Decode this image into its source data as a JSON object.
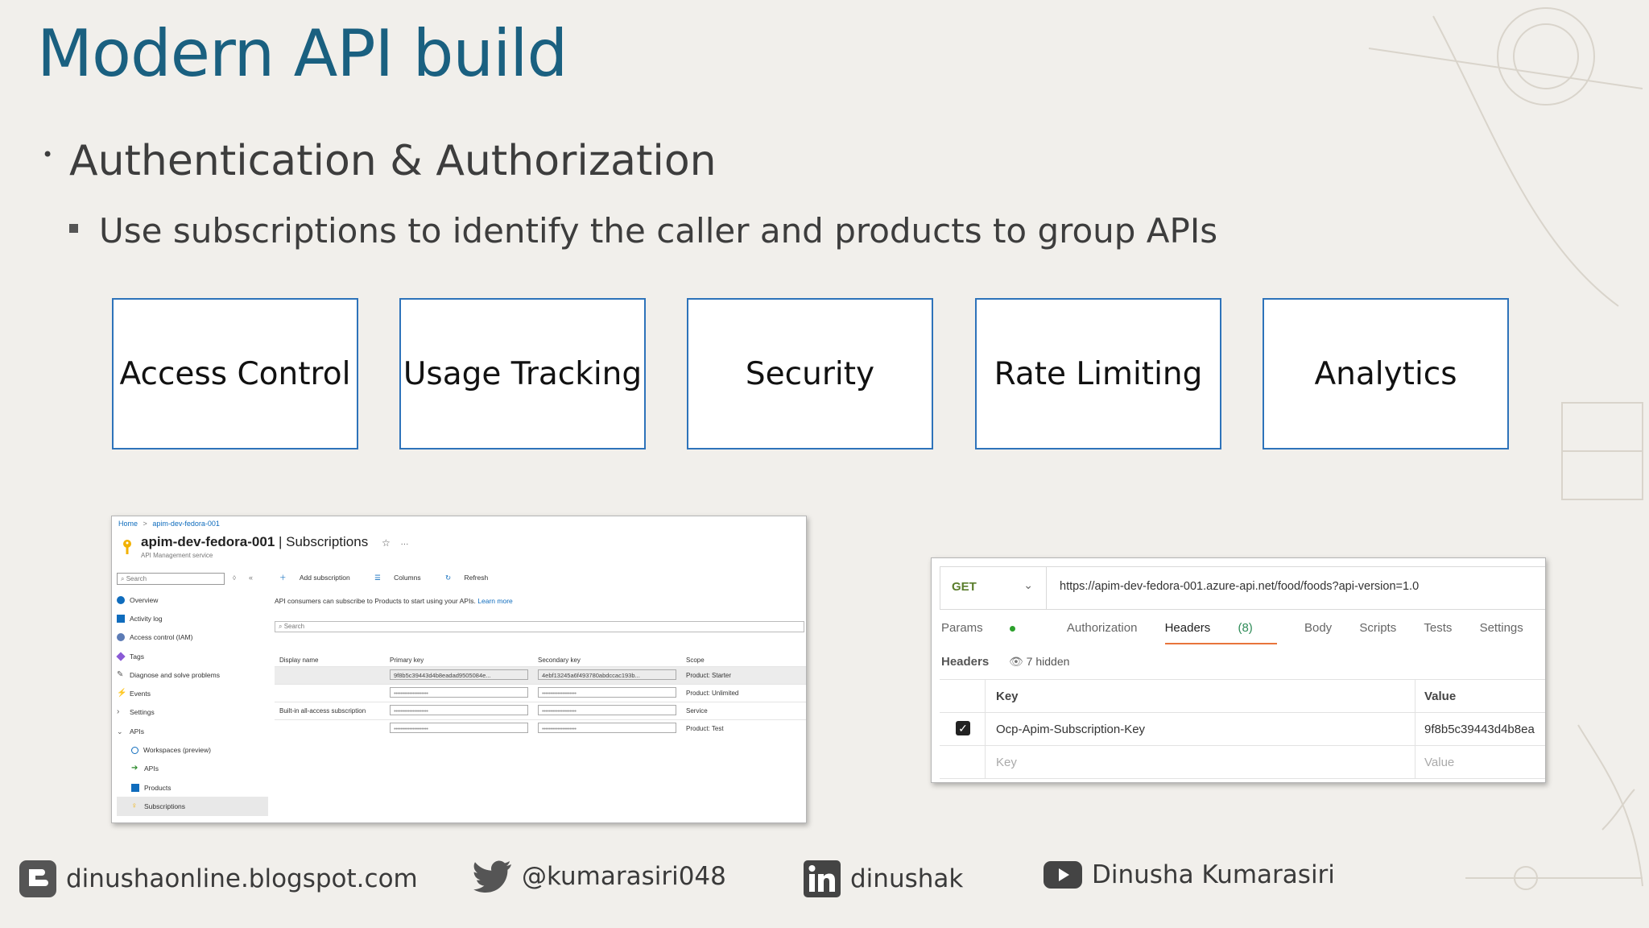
{
  "slide": {
    "title": "Modern API build",
    "bullet_level1": "Authentication & Authorization",
    "bullet_level2": "Use subscriptions to identify the caller and products to group APIs"
  },
  "feature_boxes": [
    "Access Control",
    "Usage Tracking",
    "Security",
    "Rate Limiting",
    "Analytics"
  ],
  "azure_portal": {
    "breadcrumb": [
      "Home",
      ">",
      "apim-dev-fedora-001"
    ],
    "resource_name": "apim-dev-fedora-001",
    "page_name": " | Subscriptions",
    "star": "☆",
    "more": "···",
    "resource_type": "API Management service",
    "search_placeholder": "Search",
    "sidebar": [
      {
        "label": "Overview",
        "icon": "cloud-icon",
        "color": "#0f6cbd"
      },
      {
        "label": "Activity log",
        "icon": "log-icon",
        "color": "#0f6cbd"
      },
      {
        "label": "Access control (IAM)",
        "icon": "people-icon",
        "color": "#5c7bb5"
      },
      {
        "label": "Tags",
        "icon": "tag-icon",
        "color": "#8a5ad6"
      },
      {
        "label": "Diagnose and solve problems",
        "icon": "wrench-icon",
        "color": "#555555"
      },
      {
        "label": "Events",
        "icon": "bolt-icon",
        "color": "#f2b100"
      },
      {
        "label": "Settings",
        "icon": "chevron-right-icon",
        "color": "#555555"
      },
      {
        "label": "APIs",
        "icon": "chevron-down-icon",
        "color": "#555555"
      }
    ],
    "sidebar_sub": [
      {
        "label": "Workspaces (preview)",
        "icon": "workspace-icon",
        "color": "#0f6cbd"
      },
      {
        "label": "APIs",
        "icon": "arrow-icon",
        "color": "#2c8a2c"
      },
      {
        "label": "Products",
        "icon": "product-icon",
        "color": "#0f6cbd"
      },
      {
        "label": "Subscriptions",
        "icon": "key-icon",
        "color": "#f2b100"
      }
    ],
    "toolbar": {
      "add": "Add subscription",
      "columns": "Columns",
      "refresh": "Refresh"
    },
    "info_text": "API consumers can subscribe to Products to start using your APIs.",
    "learn_more": "Learn more",
    "grid_search": "Search",
    "columns": [
      "Display name",
      "Primary key",
      "Secondary key",
      "Scope"
    ],
    "rows": [
      {
        "name": "",
        "primary": "9f8b5c39443d4b8eadad9505084e...",
        "secondary": "4ebf13245a6f493780abdccac193b...",
        "scope": "Product: Starter"
      },
      {
        "name": "",
        "primary": "••••••••••••••••••••",
        "secondary": "••••••••••••••••••••",
        "scope": "Product: Unlimited"
      },
      {
        "name": "Built-in all-access subscription",
        "primary": "••••••••••••••••••••",
        "secondary": "••••••••••••••••••••",
        "scope": "Service"
      },
      {
        "name": "",
        "primary": "••••••••••••••••••••",
        "secondary": "••••••••••••••••••••",
        "scope": "Product: Test"
      }
    ]
  },
  "postman": {
    "method": "GET",
    "url": "https://apim-dev-fedora-001.azure-api.net/food/foods?api-version=1.0",
    "tabs": [
      "Params",
      "Authorization",
      "Headers",
      "Body",
      "Scripts",
      "Tests",
      "Settings"
    ],
    "headers_count": "(8)",
    "headers_label": "Headers",
    "hidden_label": "7 hidden",
    "col_key": "Key",
    "col_value": "Value",
    "row_key": "Ocp-Apim-Subscription-Key",
    "row_value": "9f8b5c39443d4b8ea",
    "placeholder_key": "Key",
    "placeholder_value": "Value"
  },
  "footer": {
    "blog": "dinushaonline.blogspot.com",
    "twitter": "@kumarasiri048",
    "linkedin": "dinushak",
    "youtube": "Dinusha Kumarasiri"
  },
  "colors": {
    "title": "#1a6080",
    "box_border": "#2e73ba",
    "postman_tab_underline": "#e8743b"
  }
}
